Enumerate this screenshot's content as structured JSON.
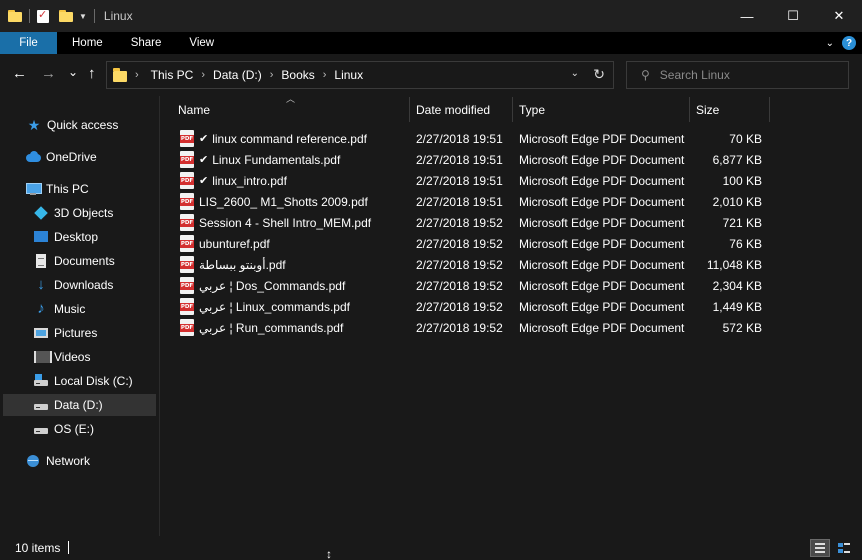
{
  "window": {
    "title": "Linux",
    "minimize_glyph": "—",
    "maximize_glyph": "☐",
    "close_glyph": "✕"
  },
  "ribbon": {
    "tabs": [
      "File",
      "Home",
      "Share",
      "View"
    ],
    "active_color": "#1a6fa8"
  },
  "nav": {
    "back_glyph": "←",
    "forward_glyph": "→",
    "recent_glyph": "⌄",
    "up_glyph": "↑",
    "breadcrumbs": [
      "This PC",
      "Data (D:)",
      "Books",
      "Linux"
    ],
    "refresh_glyph": "↻"
  },
  "search": {
    "placeholder": "Search Linux"
  },
  "sidebar": {
    "items": [
      {
        "label": "Quick access",
        "icon": "star-icon"
      },
      {
        "label": "OneDrive",
        "icon": "cloud-icon"
      },
      {
        "label": "This PC",
        "icon": "computer-icon"
      },
      {
        "label": "3D Objects",
        "icon": "cube-icon"
      },
      {
        "label": "Desktop",
        "icon": "desktop-icon"
      },
      {
        "label": "Documents",
        "icon": "document-icon"
      },
      {
        "label": "Downloads",
        "icon": "download-icon"
      },
      {
        "label": "Music",
        "icon": "music-icon"
      },
      {
        "label": "Pictures",
        "icon": "pictures-icon"
      },
      {
        "label": "Videos",
        "icon": "videos-icon"
      },
      {
        "label": "Local Disk (C:)",
        "icon": "drive-icon"
      },
      {
        "label": "Data (D:)",
        "icon": "drive-icon",
        "selected": true
      },
      {
        "label": "OS (E:)",
        "icon": "drive-icon"
      },
      {
        "label": "Network",
        "icon": "network-icon"
      }
    ]
  },
  "columns": {
    "name": "Name",
    "date": "Date modified",
    "type": "Type",
    "size": "Size"
  },
  "files": [
    {
      "name": "linux command reference.pdf",
      "synced": true,
      "date": "2/27/2018 19:51",
      "type": "Microsoft Edge PDF Document",
      "size": "70 KB"
    },
    {
      "name": "Linux Fundamentals.pdf",
      "synced": true,
      "date": "2/27/2018 19:51",
      "type": "Microsoft Edge PDF Document",
      "size": "6,877 KB"
    },
    {
      "name": "linux_intro.pdf",
      "synced": true,
      "date": "2/27/2018 19:51",
      "type": "Microsoft Edge PDF Document",
      "size": "100 KB"
    },
    {
      "name": "LIS_2600_ M1_Shotts 2009.pdf",
      "synced": false,
      "date": "2/27/2018 19:51",
      "type": "Microsoft Edge PDF Document",
      "size": "2,010 KB"
    },
    {
      "name": "Session 4 - Shell Intro_MEM.pdf",
      "synced": false,
      "date": "2/27/2018 19:52",
      "type": "Microsoft Edge PDF Document",
      "size": "721 KB"
    },
    {
      "name": "ubunturef.pdf",
      "synced": false,
      "date": "2/27/2018 19:52",
      "type": "Microsoft Edge PDF Document",
      "size": "76 KB"
    },
    {
      "name": "أوبنتو ببساطة.pdf",
      "synced": false,
      "date": "2/27/2018 19:52",
      "type": "Microsoft Edge PDF Document",
      "size": "11,048 KB"
    },
    {
      "name": "عربي ¦ Dos_Commands.pdf",
      "synced": false,
      "date": "2/27/2018 19:52",
      "type": "Microsoft Edge PDF Document",
      "size": "2,304 KB"
    },
    {
      "name": "عربي ¦ Linux_commands.pdf",
      "synced": false,
      "date": "2/27/2018 19:52",
      "type": "Microsoft Edge PDF Document",
      "size": "1,449 KB"
    },
    {
      "name": "عربي ¦ Run_commands.pdf",
      "synced": false,
      "date": "2/27/2018 19:52",
      "type": "Microsoft Edge PDF Document",
      "size": "572 KB"
    }
  ],
  "status": {
    "item_count": "10 items"
  }
}
